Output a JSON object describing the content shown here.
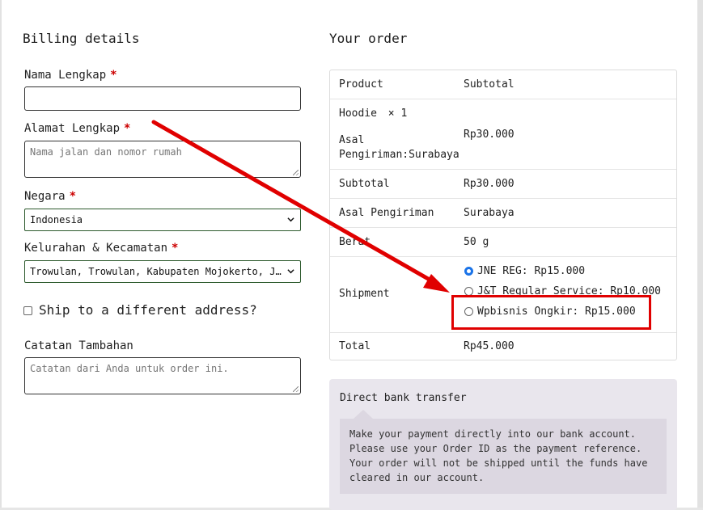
{
  "billing": {
    "heading": "Billing details",
    "fields": {
      "name": {
        "label": "Nama Lengkap",
        "required": "*",
        "value": ""
      },
      "address": {
        "label": "Alamat Lengkap",
        "required": "*",
        "placeholder": "Nama jalan dan nomor rumah"
      },
      "country": {
        "label": "Negara",
        "required": "*",
        "value": "Indonesia"
      },
      "district": {
        "label": "Kelurahan & Kecamatan",
        "required": "*",
        "value": "Trowulan, Trowulan, Kabupaten Mojokerto, Jawa Timur"
      }
    },
    "ship_different": "Ship to a different address?",
    "notes": {
      "label": "Catatan Tambahan",
      "placeholder": "Catatan dari Anda untuk order ini."
    }
  },
  "order": {
    "heading": "Your order",
    "col_product": "Product",
    "col_subtotal": "Subtotal",
    "item_name": "Hoodie",
    "item_qty": "× 1",
    "item_origin_label": "Asal Pengiriman:",
    "item_origin_value": "Surabaya",
    "item_price": "Rp30.000",
    "subtotal_label": "Subtotal",
    "subtotal_value": "Rp30.000",
    "origin_label": "Asal Pengiriman",
    "origin_value": "Surabaya",
    "weight_label": "Berat",
    "weight_value": "50 g",
    "shipment_label": "Shipment",
    "shipment_options": [
      {
        "label": "JNE REG: Rp15.000",
        "selected": true
      },
      {
        "label": "J&T Regular Service: Rp10.000",
        "selected": false
      },
      {
        "label": "Wpbisnis Ongkir: Rp15.000",
        "selected": false
      }
    ],
    "total_label": "Total",
    "total_value": "Rp45.000"
  },
  "payment": {
    "method": "Direct bank transfer",
    "description": "Make your payment directly into our bank account. Please use your Order ID as the payment reference. Your order will not be shipped until the funds have cleared in our account."
  },
  "annotation": {
    "color": "#e00000"
  }
}
